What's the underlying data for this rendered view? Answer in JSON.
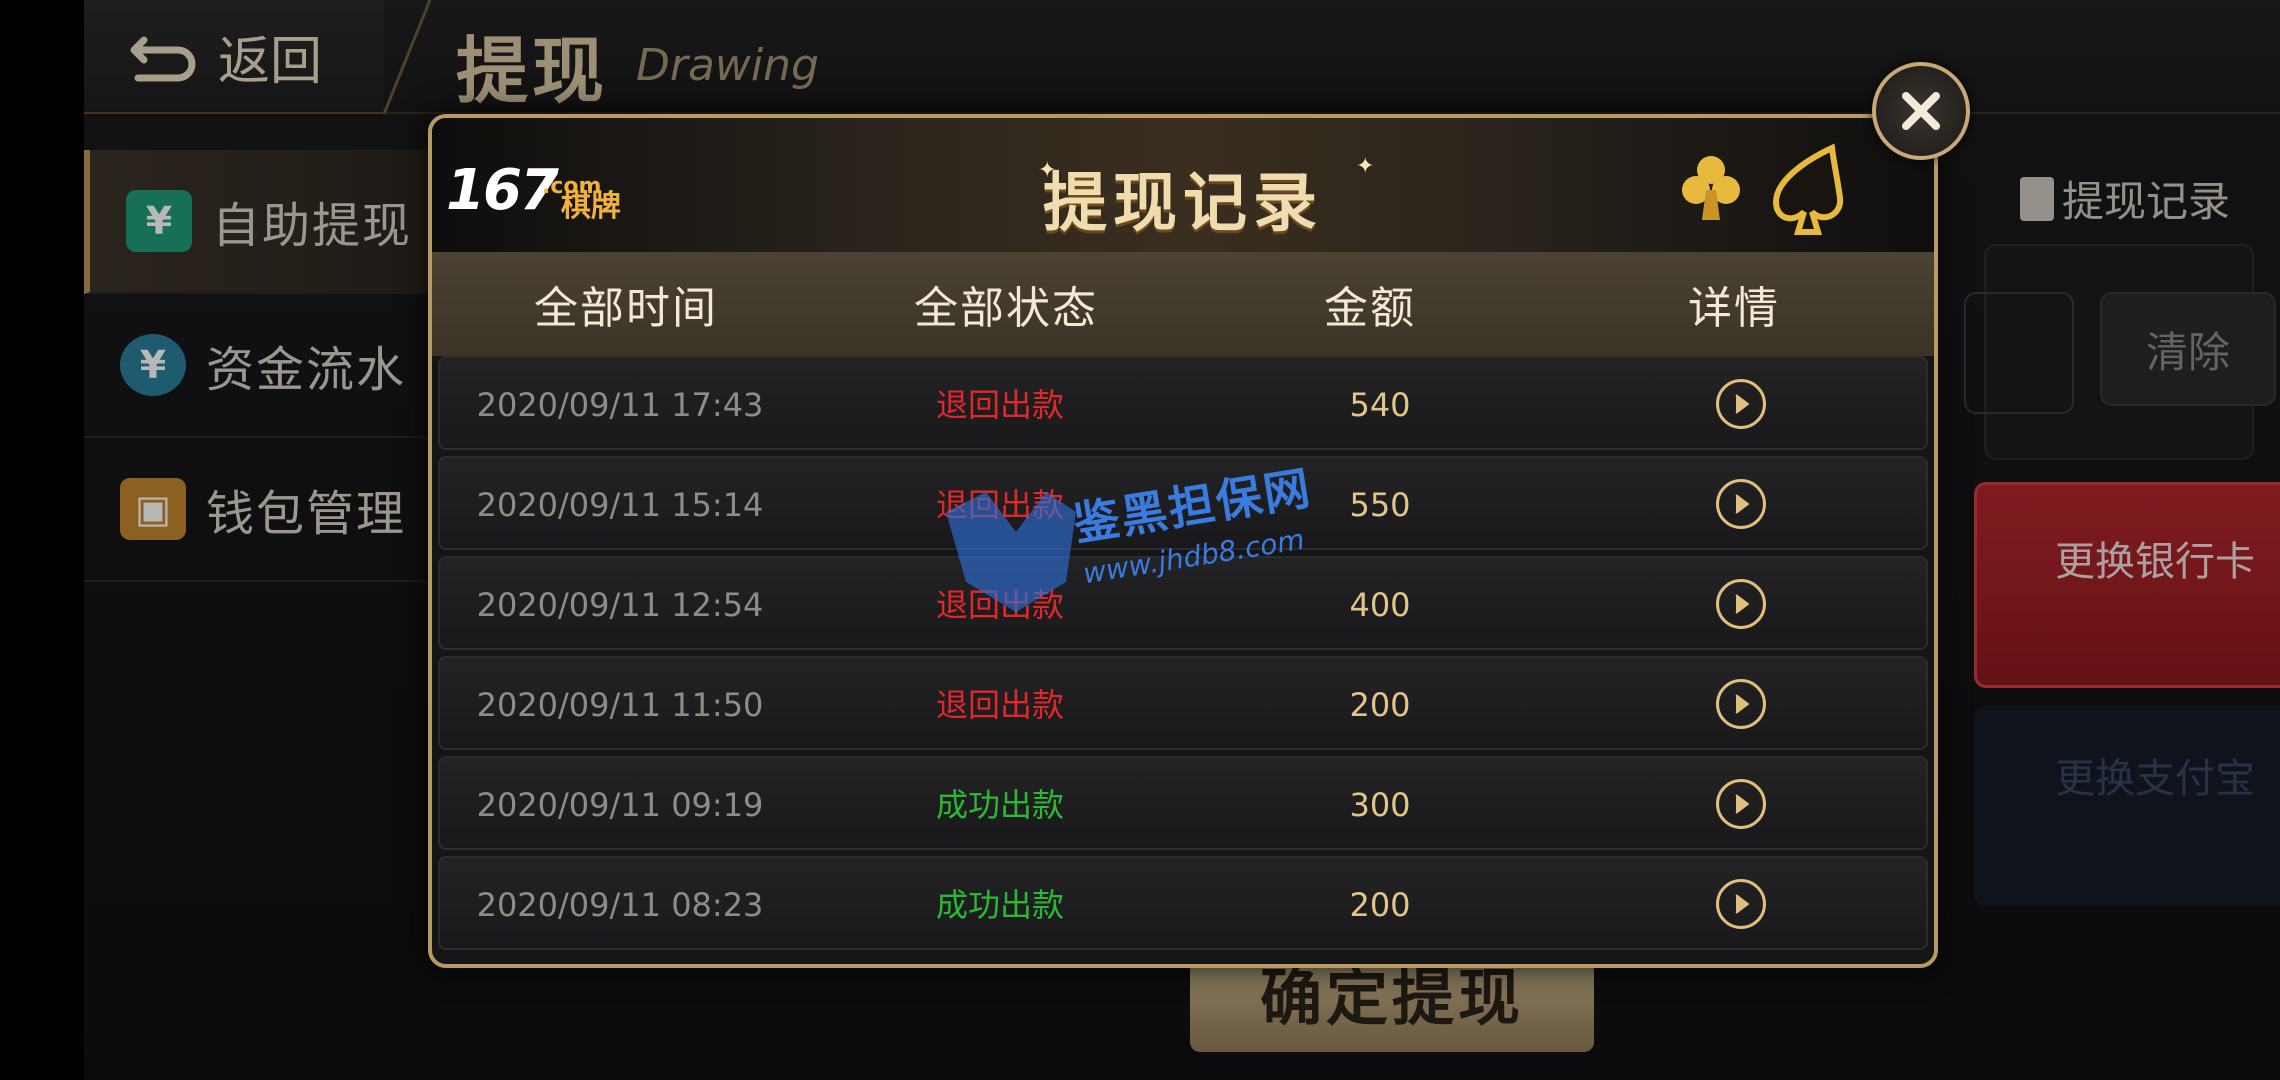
{
  "header": {
    "back_label": "返回",
    "title": "提现",
    "subtitle": "Drawing"
  },
  "sidebar": {
    "items": [
      {
        "label": "自助提现",
        "icon": "atm-icon",
        "active": true
      },
      {
        "label": "资金流水",
        "icon": "yuan-coin-icon",
        "active": false
      },
      {
        "label": "钱包管理",
        "icon": "wallet-icon",
        "active": false
      }
    ]
  },
  "background": {
    "records_link": "提现记录",
    "clear_button": "清除",
    "change_bank_button": "更换银行卡",
    "change_alipay_button": "更换支付宝",
    "confirm_button": "确定提现"
  },
  "modal": {
    "brand_number": "167",
    "brand_suffix": "棋牌",
    "brand_domain": ".com",
    "title": "提现记录",
    "columns": {
      "time": "全部时间",
      "status": "全部状态",
      "amount": "金额",
      "detail": "详情"
    },
    "rows": [
      {
        "time": "2020/09/11 17:43",
        "status": "退回出款",
        "status_type": "returned",
        "amount": "540"
      },
      {
        "time": "2020/09/11 15:14",
        "status": "退回出款",
        "status_type": "returned",
        "amount": "550"
      },
      {
        "time": "2020/09/11 12:54",
        "status": "退回出款",
        "status_type": "returned",
        "amount": "400"
      },
      {
        "time": "2020/09/11 11:50",
        "status": "退回出款",
        "status_type": "returned",
        "amount": "200"
      },
      {
        "time": "2020/09/11 09:19",
        "status": "成功出款",
        "status_type": "success",
        "amount": "300"
      },
      {
        "time": "2020/09/11 08:23",
        "status": "成功出款",
        "status_type": "success",
        "amount": "200"
      }
    ]
  },
  "watermark": {
    "text": "鉴黑担保网",
    "url": "www.jhdb8.com"
  },
  "colors": {
    "gold": "#e2bf7a",
    "status_returned": "#e0282a",
    "status_success": "#2bb833",
    "bank_button": "#b2262c"
  }
}
